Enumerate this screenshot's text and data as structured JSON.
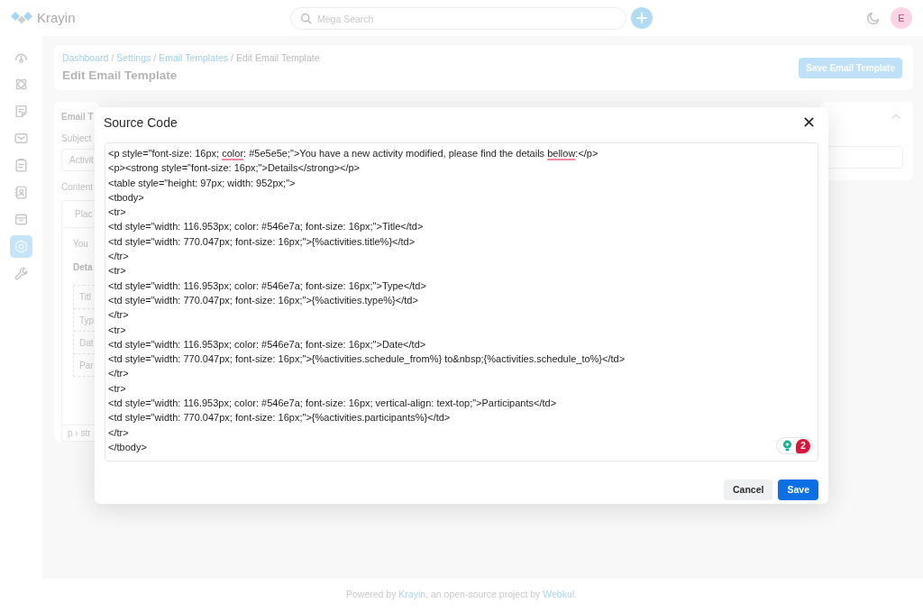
{
  "header": {
    "brand": "Krayin",
    "search": {
      "placeholder": "Mega Search"
    },
    "avatar": "E"
  },
  "sidebar": {
    "items": [
      {
        "selected": false
      },
      {
        "selected": false
      },
      {
        "selected": false
      },
      {
        "selected": false
      },
      {
        "selected": false
      },
      {
        "selected": false
      },
      {
        "selected": false
      },
      {
        "selected": true
      },
      {
        "selected": false
      }
    ]
  },
  "page": {
    "breadcrumb": {
      "separator": "/",
      "items": [
        {
          "label": "Dashboard",
          "link": true
        },
        {
          "label": "Settings",
          "link": true
        },
        {
          "label": "Email Templates",
          "link": true
        },
        {
          "label": "Edit Email Template",
          "link": false
        }
      ]
    },
    "title": "Edit Email Template",
    "save_button": "Save Email Template"
  },
  "template_card": {
    "title": "Email T",
    "subject_label": "Subject",
    "subject_value": "Activit",
    "content_label": "Content",
    "editor": {
      "toolbar": "Plac",
      "paragraph": "You",
      "heading": "Deta",
      "table_rows": [
        "Titl",
        "Typ",
        "Dat",
        "Par"
      ],
      "status_path": "p › str"
    }
  },
  "side_card": {
    "expanded": true
  },
  "modal": {
    "title": "Source Code",
    "lines": [
      [
        {
          "text": "<p style=\"font-size: 16px; ",
          "misspelled": false
        },
        {
          "text": "color",
          "misspelled": true
        },
        {
          "text": ": #5e5e5e;\">You have a new activity modified, please find the details ",
          "misspelled": false
        },
        {
          "text": "bellow",
          "misspelled": true
        },
        {
          "text": ":</p>",
          "misspelled": false
        }
      ],
      "<p><strong style=\"font-size: 16px;\">Details</strong></p>",
      "<table style=\"height: 97px; width: 952px;\">",
      "<tbody>",
      "<tr>",
      "<td style=\"width: 116.953px; color: #546e7a; font-size: 16px;\">Title</td>",
      "<td style=\"width: 770.047px; font-size: 16px;\">{%activities.title%}</td>",
      "</tr>",
      "<tr>",
      "<td style=\"width: 116.953px; color: #546e7a; font-size: 16px;\">Type</td>",
      "<td style=\"width: 770.047px; font-size: 16px;\">{%activities.type%}</td>",
      "</tr>",
      "<tr>",
      "<td style=\"width: 116.953px; color: #546e7a; font-size: 16px;\">Date</td>",
      "<td style=\"width: 770.047px; font-size: 16px;\">{%activities.schedule_from%} to&nbsp;{%activities.schedule_to%}</td>",
      "</tr>",
      "<tr>",
      "<td style=\"width: 116.953px; color: #546e7a; font-size: 16px; vertical-align: text-top;\">Participants</td>",
      "<td style=\"width: 770.047px; font-size: 16px;\">{%activities.participants%}</td>",
      "</tr>",
      "</tbody>"
    ],
    "assistant": {
      "count": "2"
    },
    "buttons": [
      {
        "label": "Cancel",
        "kind": "secondary"
      },
      {
        "label": "Save",
        "kind": "primary"
      }
    ]
  },
  "footer": {
    "segments": [
      {
        "text": "Powered by ",
        "kind": "text"
      },
      {
        "text": "Krayin",
        "kind": "link"
      },
      {
        "text": ", an open-source project by ",
        "kind": "text"
      },
      {
        "text": "Webkul",
        "kind": "link"
      },
      {
        "text": ".",
        "kind": "text"
      }
    ]
  }
}
